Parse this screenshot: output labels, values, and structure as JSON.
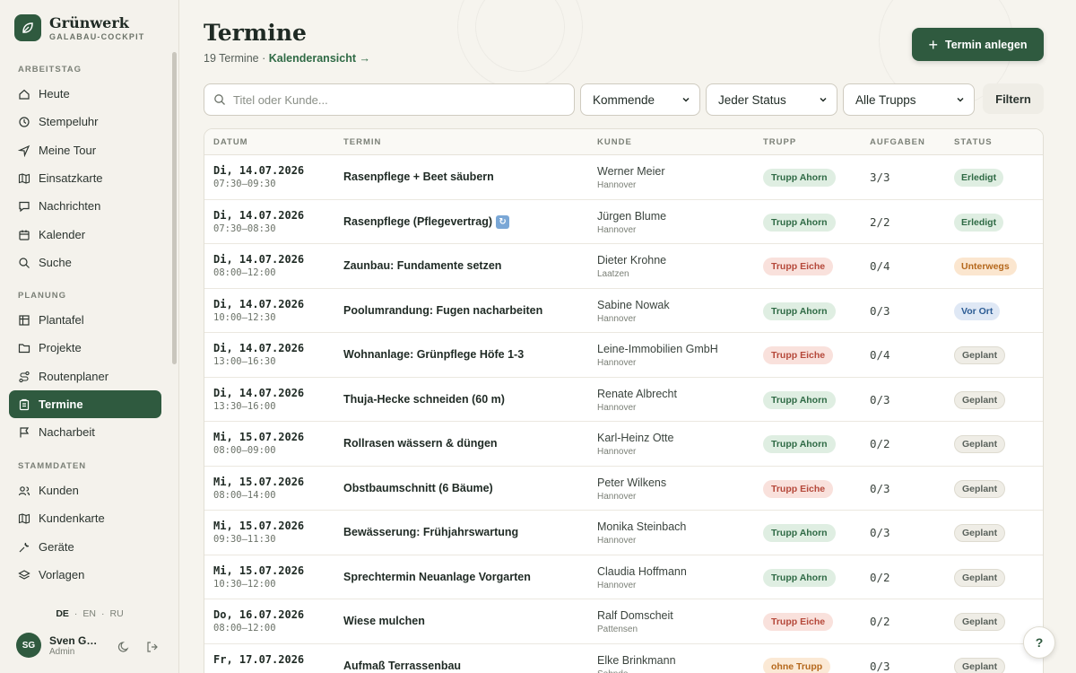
{
  "brand": {
    "name": "Grünwerk",
    "subtitle": "GALABAU-COCKPIT"
  },
  "sidebar": {
    "sections": [
      {
        "title": "ARBEITSTAG",
        "items": [
          {
            "label": "Heute",
            "icon": "home-icon"
          },
          {
            "label": "Stempeluhr",
            "icon": "clock-icon"
          },
          {
            "label": "Meine Tour",
            "icon": "navigation-icon"
          },
          {
            "label": "Einsatzkarte",
            "icon": "map-icon"
          },
          {
            "label": "Nachrichten",
            "icon": "message-icon"
          },
          {
            "label": "Kalender",
            "icon": "calendar-icon"
          },
          {
            "label": "Suche",
            "icon": "search-icon"
          }
        ]
      },
      {
        "title": "PLANUNG",
        "items": [
          {
            "label": "Plantafel",
            "icon": "grid-icon"
          },
          {
            "label": "Projekte",
            "icon": "folder-icon"
          },
          {
            "label": "Routenplaner",
            "icon": "route-icon"
          },
          {
            "label": "Termine",
            "icon": "clipboard-icon",
            "active": true
          },
          {
            "label": "Nacharbeit",
            "icon": "flag-icon"
          }
        ]
      },
      {
        "title": "STAMMDATEN",
        "items": [
          {
            "label": "Kunden",
            "icon": "users-icon"
          },
          {
            "label": "Kundenkarte",
            "icon": "map-icon"
          },
          {
            "label": "Geräte",
            "icon": "tool-icon"
          },
          {
            "label": "Vorlagen",
            "icon": "layers-icon"
          }
        ]
      }
    ],
    "languages": [
      "DE",
      "EN",
      "RU"
    ],
    "active_language": "DE",
    "user": {
      "initials": "SG",
      "name": "Sven Ga…",
      "role": "Admin"
    }
  },
  "header": {
    "title": "Termine",
    "count_text": "19 Termine ·",
    "calendar_link": "Kalenderansicht →",
    "add_button": "Termin anlegen"
  },
  "filters": {
    "search_placeholder": "Titel oder Kunde...",
    "time": "Kommende",
    "status": "Jeder Status",
    "trupp": "Alle Trupps",
    "filter_button": "Filtern"
  },
  "table": {
    "columns": [
      "DATUM",
      "TERMIN",
      "KUNDE",
      "TRUPP",
      "AUFGABEN",
      "STATUS"
    ],
    "rows": [
      {
        "date": "Di, 14.07.2026",
        "time": "07:30–09:30",
        "title": "Rasenpflege + Beet säubern",
        "customer": "Werner Meier",
        "city": "Hannover",
        "trupp": "Trupp Ahorn",
        "tasks": "3/3",
        "status": "Erledigt"
      },
      {
        "date": "Di, 14.07.2026",
        "time": "07:30–08:30",
        "title": "Rasenpflege (Pflegevertrag)",
        "recurring": true,
        "customer": "Jürgen Blume",
        "city": "Hannover",
        "trupp": "Trupp Ahorn",
        "tasks": "2/2",
        "status": "Erledigt"
      },
      {
        "date": "Di, 14.07.2026",
        "time": "08:00–12:00",
        "title": "Zaunbau: Fundamente setzen",
        "customer": "Dieter Krohne",
        "city": "Laatzen",
        "trupp": "Trupp Eiche",
        "tasks": "0/4",
        "status": "Unterwegs"
      },
      {
        "date": "Di, 14.07.2026",
        "time": "10:00–12:30",
        "title": "Poolumrandung: Fugen nacharbeiten",
        "customer": "Sabine Nowak",
        "city": "Hannover",
        "trupp": "Trupp Ahorn",
        "tasks": "0/3",
        "status": "Vor Ort"
      },
      {
        "date": "Di, 14.07.2026",
        "time": "13:00–16:30",
        "title": "Wohnanlage: Grünpflege Höfe 1-3",
        "customer": "Leine-Immobilien GmbH",
        "city": "Hannover",
        "trupp": "Trupp Eiche",
        "tasks": "0/4",
        "status": "Geplant"
      },
      {
        "date": "Di, 14.07.2026",
        "time": "13:30–16:00",
        "title": "Thuja-Hecke schneiden (60 m)",
        "customer": "Renate Albrecht",
        "city": "Hannover",
        "trupp": "Trupp Ahorn",
        "tasks": "0/3",
        "status": "Geplant"
      },
      {
        "date": "Mi, 15.07.2026",
        "time": "08:00–09:00",
        "title": "Rollrasen wässern & düngen",
        "customer": "Karl-Heinz Otte",
        "city": "Hannover",
        "trupp": "Trupp Ahorn",
        "tasks": "0/2",
        "status": "Geplant"
      },
      {
        "date": "Mi, 15.07.2026",
        "time": "08:00–14:00",
        "title": "Obstbaumschnitt (6 Bäume)",
        "customer": "Peter Wilkens",
        "city": "Hannover",
        "trupp": "Trupp Eiche",
        "tasks": "0/3",
        "status": "Geplant"
      },
      {
        "date": "Mi, 15.07.2026",
        "time": "09:30–11:30",
        "title": "Bewässerung: Frühjahrswartung",
        "customer": "Monika Steinbach",
        "city": "Hannover",
        "trupp": "Trupp Ahorn",
        "tasks": "0/3",
        "status": "Geplant"
      },
      {
        "date": "Mi, 15.07.2026",
        "time": "10:30–12:00",
        "title": "Sprechtermin Neuanlage Vorgarten",
        "customer": "Claudia Hoffmann",
        "city": "Hannover",
        "trupp": "Trupp Ahorn",
        "tasks": "0/2",
        "status": "Geplant"
      },
      {
        "date": "Do, 16.07.2026",
        "time": "08:00–12:00",
        "title": "Wiese mulchen",
        "customer": "Ralf Domscheit",
        "city": "Pattensen",
        "trupp": "Trupp Eiche",
        "tasks": "0/2",
        "status": "Geplant"
      },
      {
        "date": "Fr, 17.07.2026",
        "time": "",
        "title": "Aufmaß Terrassenbau",
        "customer": "Elke Brinkmann",
        "city": "Sehnde",
        "trupp": "ohne Trupp",
        "tasks": "0/3",
        "status": "Geplant"
      }
    ]
  },
  "help_label": "?",
  "colors": {
    "accent": "#2f5a3f",
    "background": "#f6f4ee"
  }
}
